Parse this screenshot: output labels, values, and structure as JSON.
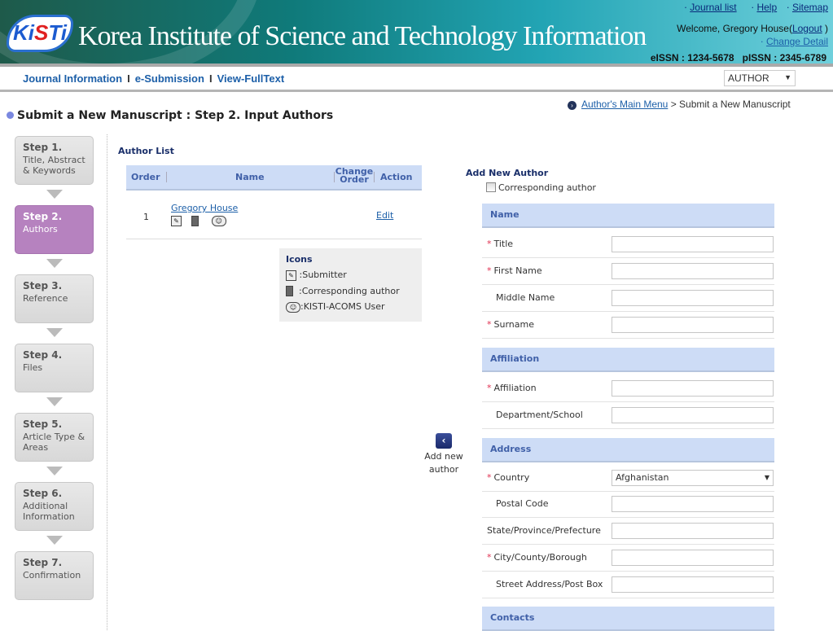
{
  "header": {
    "logo_text": "KISTI",
    "logo_url_text": "www.kisti.re.kr",
    "site_title": "Korea Institute of Science and Technology Information",
    "links": [
      "Journal list",
      "Help",
      "Sitemap"
    ],
    "welcome": "Welcome, Gregory House(",
    "logout": "Logout",
    "welcome_close": ")",
    "change_detail": "Change Detail",
    "eissn": "eISSN : 1234-5678",
    "pissn": "pISSN : 2345-6789"
  },
  "nav": {
    "items": [
      "Journal Information",
      "e-Submission",
      "View-FullText"
    ],
    "separator": "I",
    "role": "AUTHOR"
  },
  "breadcrumb": {
    "link": "Author's Main Menu",
    "current": "> Submit a New Manuscript"
  },
  "page_title": "Submit a New Manuscript : Step 2. Input Authors",
  "steps": [
    {
      "num": "Step 1.",
      "label": "Title, Abstract & Keywords"
    },
    {
      "num": "Step 2.",
      "label": "Authors",
      "active": true
    },
    {
      "num": "Step 3.",
      "label": "Reference"
    },
    {
      "num": "Step 4.",
      "label": "Files"
    },
    {
      "num": "Step 5.",
      "label": "Article Type & Areas"
    },
    {
      "num": "Step 6.",
      "label": "Additional Information"
    },
    {
      "num": "Step 7.",
      "label": "Confirmation"
    }
  ],
  "author_list": {
    "title": "Author List",
    "columns": [
      "Order",
      "Name",
      "Change Order",
      "Action"
    ],
    "rows": [
      {
        "order": "1",
        "name": "Gregory House",
        "icons": [
          "submitter-icon",
          "corresponding-author-icon",
          "kisti-acoms-user-icon"
        ],
        "action": "Edit"
      }
    ]
  },
  "icons_legend": {
    "title": "Icons",
    "items": [
      ":Submitter",
      ":Corresponding author",
      ":KISTI-ACOMS User"
    ]
  },
  "add_button": {
    "label": "Add new author"
  },
  "form": {
    "title": "Add New Author",
    "corresponding_label": "Corresponding author",
    "corresponding_checked": false,
    "required_mark": "*",
    "sections": {
      "name": "Name",
      "affiliation": "Affiliation",
      "address": "Address",
      "contacts": "Contacts"
    },
    "fields": {
      "title": "Title",
      "first_name": "First Name",
      "middle_name": "Middle Name",
      "surname": "Surname",
      "affiliation": "Affiliation",
      "department": "Department/School",
      "country": "Country",
      "country_value": "Afghanistan",
      "postal": "Postal Code",
      "state": "State/Province/Prefecture",
      "city": "City/County/Borough",
      "street": "Street Address/Post Box"
    }
  },
  "colors": {
    "header_teal": "#0f7a7a",
    "step_active": "#b682bf",
    "table_header": "#cddcf6",
    "link": "#1c5fa8",
    "required": "#e03050"
  }
}
